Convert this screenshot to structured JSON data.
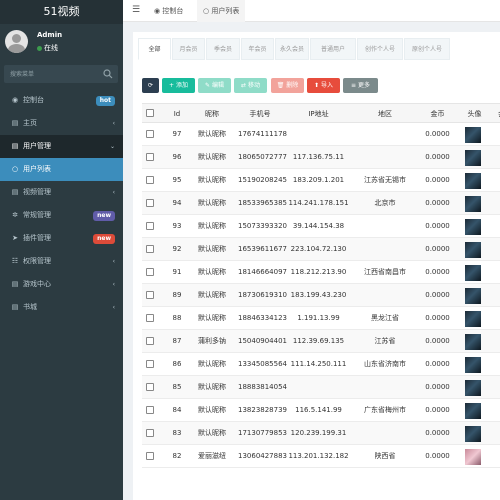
{
  "app": {
    "logo": "51视频"
  },
  "user": {
    "name": "Admin",
    "status": "在线"
  },
  "search": {
    "placeholder": "搜索菜单"
  },
  "sidebar": {
    "items": [
      {
        "label": "控制台",
        "icon": "dashboard-icon",
        "badge": "hot",
        "badge_color": "#3c8dbc"
      },
      {
        "label": "主页",
        "icon": "list-icon",
        "arrow": "‹"
      },
      {
        "label": "用户管理",
        "icon": "list-icon",
        "arrow": "⌄",
        "open": true,
        "children": [
          {
            "label": "用户列表",
            "icon": "circle-icon",
            "active": true
          }
        ]
      },
      {
        "label": "视频管理",
        "icon": "list-icon",
        "arrow": "‹"
      },
      {
        "label": "常规管理",
        "icon": "gears-icon",
        "badge": "new",
        "badge_color": "#605ca8"
      },
      {
        "label": "插件管理",
        "icon": "rocket-icon",
        "badge": "new",
        "badge_color": "#dd4b39"
      },
      {
        "label": "权限管理",
        "icon": "group-icon",
        "arrow": "‹"
      },
      {
        "label": "游戏中心",
        "icon": "list-icon",
        "arrow": "‹"
      },
      {
        "label": "书城",
        "icon": "list-icon",
        "arrow": "‹"
      }
    ]
  },
  "topbar": {
    "tabs": [
      {
        "label": "控制台",
        "icon": "dashboard-icon"
      },
      {
        "label": "用户列表",
        "icon": "circle-icon",
        "active": true
      }
    ]
  },
  "filters": [
    "全部",
    "月会员",
    "季会员",
    "年会员",
    "永久会员",
    "普通用户",
    "创作个人号",
    "原创个人号"
  ],
  "toolbar": {
    "refresh": "",
    "add": "+ 添加",
    "edit": "✎ 编辑",
    "move": "⇄ 移动",
    "delete": "🗑 删除",
    "import": "⬆ 导入",
    "more": "≡ 更多"
  },
  "colors": {
    "sidebar": "#2c3b41",
    "active": "#3c8dbc",
    "add": "#18bc9c",
    "delete": "#e74c3c",
    "import": "#e74c3c",
    "more": "#7b8a8b",
    "refresh": "#2c3e50"
  },
  "table": {
    "columns": [
      "Id",
      "昵称",
      "手机号",
      "IP地址",
      "地区",
      "金币",
      "头像",
      "会"
    ],
    "rows": [
      {
        "id": "97",
        "nick": "默认昵称",
        "phone": "17674111178",
        "ip": "",
        "region": "",
        "coins": "0.0000",
        "avatar": "dark"
      },
      {
        "id": "96",
        "nick": "默认昵称",
        "phone": "18065072777",
        "ip": "117.136.75.11",
        "region": "",
        "coins": "0.0000",
        "avatar": "dark"
      },
      {
        "id": "95",
        "nick": "默认昵称",
        "phone": "15190208245",
        "ip": "183.209.1.201",
        "region": "江苏省无锡市",
        "coins": "0.0000",
        "avatar": "dark"
      },
      {
        "id": "94",
        "nick": "默认昵称",
        "phone": "18533965385",
        "ip": "114.241.178.151",
        "region": "北京市",
        "coins": "0.0000",
        "avatar": "dark"
      },
      {
        "id": "93",
        "nick": "默认昵称",
        "phone": "15073393320",
        "ip": "39.144.154.38",
        "region": "",
        "coins": "0.0000",
        "avatar": "dark"
      },
      {
        "id": "92",
        "nick": "默认昵称",
        "phone": "16539611677",
        "ip": "223.104.72.130",
        "region": "",
        "coins": "0.0000",
        "avatar": "dark"
      },
      {
        "id": "91",
        "nick": "默认昵称",
        "phone": "18146664097",
        "ip": "118.212.213.90",
        "region": "江西省南昌市",
        "coins": "0.0000",
        "avatar": "dark"
      },
      {
        "id": "89",
        "nick": "默认昵称",
        "phone": "18730619310",
        "ip": "183.199.43.230",
        "region": "",
        "coins": "0.0000",
        "avatar": "dark"
      },
      {
        "id": "88",
        "nick": "默认昵称",
        "phone": "18846334123",
        "ip": "1.191.13.99",
        "region": "黑龙江省",
        "coins": "0.0000",
        "avatar": "dark"
      },
      {
        "id": "87",
        "nick": "蒲利多钠",
        "phone": "15040904401",
        "ip": "112.39.69.135",
        "region": "江苏省",
        "coins": "0.0000",
        "avatar": "dark"
      },
      {
        "id": "86",
        "nick": "默认昵称",
        "phone": "13345085564",
        "ip": "111.14.250.111",
        "region": "山东省济南市",
        "coins": "0.0000",
        "avatar": "dark"
      },
      {
        "id": "85",
        "nick": "默认昵称",
        "phone": "18883814054",
        "ip": "",
        "region": "",
        "coins": "0.0000",
        "avatar": "dark"
      },
      {
        "id": "84",
        "nick": "默认昵称",
        "phone": "13823828739",
        "ip": "116.5.141.99",
        "region": "广东省梅州市",
        "coins": "0.0000",
        "avatar": "dark"
      },
      {
        "id": "83",
        "nick": "默认昵称",
        "phone": "17130779853",
        "ip": "120.239.199.31",
        "region": "",
        "coins": "0.0000",
        "avatar": "dark"
      },
      {
        "id": "82",
        "nick": "爱丽滋纽",
        "phone": "13060427883",
        "ip": "113.201.132.182",
        "region": "陕西省",
        "coins": "0.0000",
        "avatar": "pink"
      }
    ]
  }
}
